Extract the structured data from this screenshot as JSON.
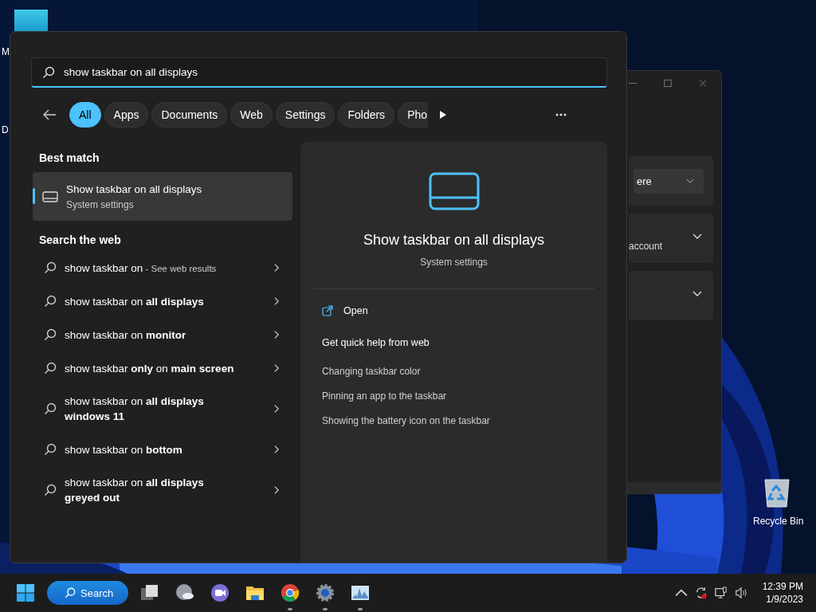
{
  "desktop": {
    "icons": [
      {
        "kind": "app",
        "label": "M"
      },
      {
        "kind": "doc",
        "label": "D"
      },
      {
        "kind": "recycle",
        "label": "Recycle Bin"
      }
    ]
  },
  "background_window": {
    "rows": [
      {
        "kind": "dropdown",
        "text": "ere"
      },
      {
        "kind": "expander",
        "text": "account"
      },
      {
        "kind": "expander"
      }
    ]
  },
  "search": {
    "query": "show taskbar on all displays",
    "filters": [
      {
        "label": "All",
        "selected": true
      },
      {
        "label": "Apps",
        "selected": false
      },
      {
        "label": "Documents",
        "selected": false
      },
      {
        "label": "Web",
        "selected": false
      },
      {
        "label": "Settings",
        "selected": false
      },
      {
        "label": "Folders",
        "selected": false
      },
      {
        "label": "Pho",
        "selected": false
      }
    ],
    "best_match": {
      "heading": "Best match",
      "title": "Show taskbar on all displays",
      "subtitle": "System settings",
      "selected": true
    },
    "web": {
      "heading": "Search the web",
      "items": [
        {
          "text": "show taskbar on",
          "suffix": " - See web results"
        },
        {
          "text": "show taskbar on **all displays**"
        },
        {
          "text": "show taskbar on **monitor**"
        },
        {
          "text": "show taskbar **only** on **main screen**"
        },
        {
          "text": "show taskbar on **all displays**",
          "second_line": "windows 11"
        },
        {
          "text": "show taskbar on **bottom**"
        },
        {
          "text": "show taskbar on **all displays**",
          "second_line": "greyed out"
        }
      ]
    },
    "preview": {
      "title": "Show taskbar on all displays",
      "subtitle": "System settings",
      "action": "Open",
      "help_heading": "Get quick help from web",
      "links": [
        "Changing taskbar color",
        "Pinning an app to the taskbar",
        "Showing the battery icon on the taskbar"
      ]
    }
  },
  "taskbar": {
    "search_label": "Search",
    "apps": [
      {
        "kind": "taskview",
        "running": false
      },
      {
        "kind": "weather",
        "running": false
      },
      {
        "kind": "meet",
        "running": false
      },
      {
        "kind": "explorer",
        "running": false
      },
      {
        "kind": "chrome",
        "running": true
      },
      {
        "kind": "settings",
        "running": true
      },
      {
        "kind": "monitor",
        "running": true
      }
    ],
    "clock": {
      "time": "12:39 PM",
      "date": "1/9/2023"
    }
  }
}
